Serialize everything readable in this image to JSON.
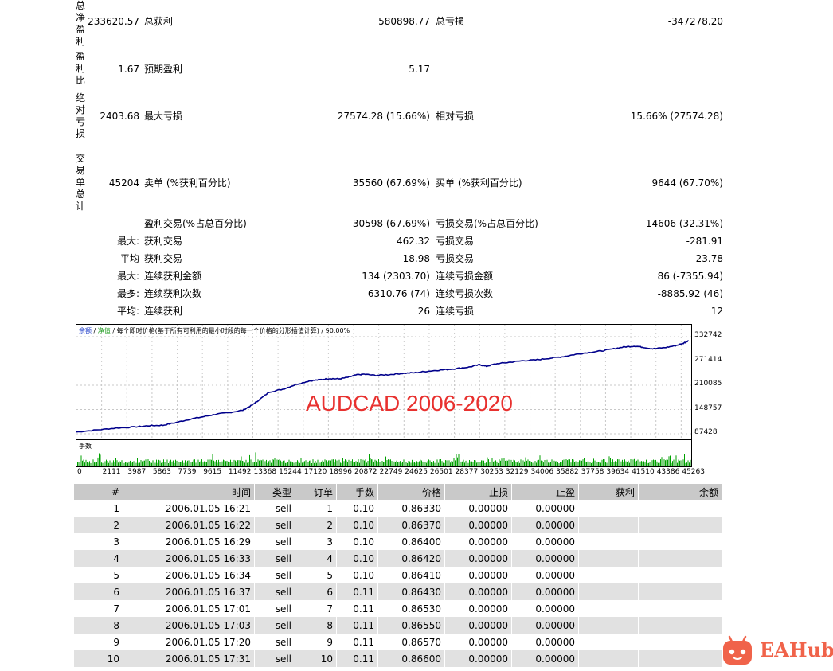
{
  "summary": {
    "net_profit": {
      "label": "总净盈利",
      "value": "233620.57",
      "left_label": "总获利",
      "left_value": "580898.77",
      "right_label": "总亏损",
      "right_value": "-347278.20"
    },
    "profit_factor": {
      "label": "盈利比",
      "value": "1.67",
      "left_label": "预期盈利",
      "left_value": "5.17"
    },
    "abs_drawdown": {
      "label": "绝对亏损",
      "value": "2403.68",
      "left_label": "最大亏损",
      "left_value": "27574.28 (15.66%)",
      "right_label": "相对亏损",
      "right_value": "15.66% (27574.28)"
    },
    "total_trades": {
      "label": "交易单总计",
      "value": "45204",
      "left_label": "卖单 (%获利百分比)",
      "left_value": "35560 (67.69%)",
      "right_label": "买单 (%获利百分比)",
      "right_value": "9644 (67.70%)"
    },
    "rows": [
      {
        "prefix": "",
        "left_label": "盈利交易(%占总百分比)",
        "left_value": "30598 (67.69%)",
        "right_label": "亏损交易(%占总百分比)",
        "right_value": "14606 (32.31%)"
      },
      {
        "prefix": "最大:",
        "left_label": "获利交易",
        "left_value": "462.32",
        "right_label": "亏损交易",
        "right_value": "-281.91"
      },
      {
        "prefix": "平均",
        "left_label": "获利交易",
        "left_value": "18.98",
        "right_label": "亏损交易",
        "right_value": "-23.78"
      },
      {
        "prefix": "最大:",
        "left_label": "连续获利金额",
        "left_value": "134 (2303.70)",
        "right_label": "连续亏损金额",
        "right_value": "86 (-7355.94)"
      },
      {
        "prefix": "最多:",
        "left_label": "连续获利次数",
        "left_value": "6310.76 (74)",
        "right_label": "连续亏损次数",
        "right_value": "-8885.92 (46)"
      },
      {
        "prefix": "平均:",
        "left_label": "连续获利",
        "left_value": "26",
        "right_label": "连续亏损",
        "right_value": "12"
      }
    ]
  },
  "chart_data": {
    "type": "line",
    "legend": {
      "balance": "余额",
      "equity": "净值",
      "desc": "每个即时价格(基于所有可利用的最小时段的每一个价格的分形插值计算)",
      "quality": "90.00%"
    },
    "overlay_title": "AUDCAD 2006-2020",
    "volume_label": "手数",
    "ylim": [
      87428,
      332742
    ],
    "y_ticks": [
      "332742",
      "271414",
      "210085",
      "148757",
      "87428"
    ],
    "x_ticks": [
      "0",
      "2111",
      "3987",
      "5863",
      "7739",
      "9615",
      "11492",
      "13368",
      "15244",
      "17120",
      "18996",
      "20872",
      "22749",
      "24625",
      "26501",
      "28377",
      "30253",
      "32129",
      "34006",
      "35882",
      "37758",
      "39634",
      "41510",
      "43386",
      "45263"
    ],
    "xlim": [
      0,
      46200
    ],
    "balance_x": [
      0,
      1500,
      3000,
      4500,
      5500,
      6500,
      7500,
      8500,
      9600,
      10500,
      11500,
      12500,
      13200,
      13600,
      14500,
      15500,
      16500,
      17500,
      18300,
      19000,
      19700,
      20400,
      21000,
      21600,
      22500,
      23500,
      24500,
      25500,
      26500,
      27500,
      28500,
      29500,
      30300,
      30800,
      31500,
      32500,
      33500,
      34500,
      35500,
      36500,
      37500,
      38500,
      39500,
      40500,
      41200,
      42000,
      42600,
      43300,
      44200,
      45000,
      45600,
      46000
    ],
    "balance_y": [
      92000,
      97000,
      102000,
      105000,
      108000,
      109000,
      116000,
      124000,
      131000,
      137000,
      141000,
      147000,
      160000,
      170000,
      193000,
      200000,
      212000,
      221000,
      224000,
      227000,
      226000,
      230000,
      236000,
      238000,
      235000,
      237000,
      240000,
      242000,
      246000,
      249000,
      252000,
      256000,
      262000,
      258000,
      264000,
      268000,
      272000,
      274000,
      278000,
      282000,
      288000,
      293000,
      297000,
      303000,
      307000,
      309000,
      306000,
      302000,
      305000,
      310000,
      316000,
      323000
    ],
    "color_balance": "#00008b",
    "color_overlay": "#e8312f",
    "color_volume": "#00a000"
  },
  "table": {
    "headers": [
      "#",
      "时间",
      "类型",
      "订单",
      "手数",
      "价格",
      "止损",
      "止盈",
      "获利",
      "余额"
    ],
    "rows": [
      [
        "1",
        "2006.01.05 16:21",
        "sell",
        "1",
        "0.10",
        "0.86330",
        "0.00000",
        "0.00000",
        "",
        ""
      ],
      [
        "2",
        "2006.01.05 16:22",
        "sell",
        "2",
        "0.10",
        "0.86370",
        "0.00000",
        "0.00000",
        "",
        ""
      ],
      [
        "3",
        "2006.01.05 16:29",
        "sell",
        "3",
        "0.10",
        "0.86400",
        "0.00000",
        "0.00000",
        "",
        ""
      ],
      [
        "4",
        "2006.01.05 16:33",
        "sell",
        "4",
        "0.10",
        "0.86420",
        "0.00000",
        "0.00000",
        "",
        ""
      ],
      [
        "5",
        "2006.01.05 16:34",
        "sell",
        "5",
        "0.10",
        "0.86410",
        "0.00000",
        "0.00000",
        "",
        ""
      ],
      [
        "6",
        "2006.01.05 16:37",
        "sell",
        "6",
        "0.11",
        "0.86430",
        "0.00000",
        "0.00000",
        "",
        ""
      ],
      [
        "7",
        "2006.01.05 17:01",
        "sell",
        "7",
        "0.11",
        "0.86530",
        "0.00000",
        "0.00000",
        "",
        ""
      ],
      [
        "8",
        "2006.01.05 17:03",
        "sell",
        "8",
        "0.11",
        "0.86550",
        "0.00000",
        "0.00000",
        "",
        ""
      ],
      [
        "9",
        "2006.01.05 17:20",
        "sell",
        "9",
        "0.11",
        "0.86570",
        "0.00000",
        "0.00000",
        "",
        ""
      ],
      [
        "10",
        "2006.01.05 17:31",
        "sell",
        "10",
        "0.11",
        "0.86600",
        "0.00000",
        "0.00000",
        "",
        ""
      ]
    ]
  },
  "logo": {
    "text": "EAHub",
    "color": "#f0634a"
  }
}
